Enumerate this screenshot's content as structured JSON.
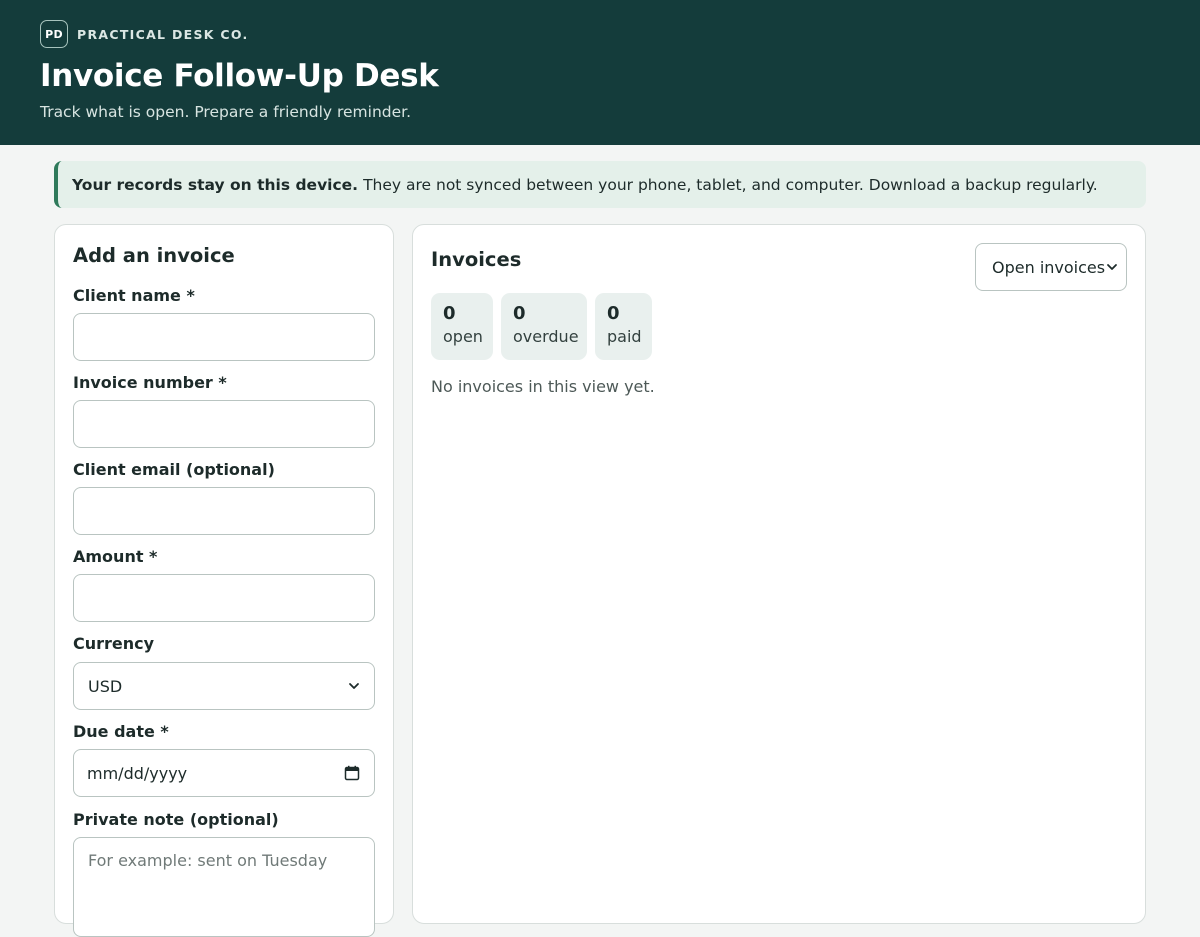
{
  "header": {
    "logo_text": "PD",
    "brand_name": "PRACTICAL DESK CO.",
    "title": "Invoice Follow-Up Desk",
    "subtitle": "Track what is open. Prepare a friendly reminder."
  },
  "notice": {
    "bold_text": "Your records stay on this device.",
    "text": "They are not synced between your phone, tablet, and computer. Download a backup regularly."
  },
  "form": {
    "title": "Add an invoice",
    "client_name": {
      "label": "Client name *",
      "value": ""
    },
    "invoice_number": {
      "label": "Invoice number *",
      "value": ""
    },
    "client_email": {
      "label": "Client email (optional)",
      "value": ""
    },
    "amount": {
      "label": "Amount *",
      "value": ""
    },
    "currency": {
      "label": "Currency",
      "value": "USD"
    },
    "due_date": {
      "label": "Due date *",
      "placeholder": "mm/dd/yyyy"
    },
    "private_note": {
      "label": "Private note (optional)",
      "placeholder": "For example: sent on Tuesday"
    }
  },
  "invoices": {
    "title": "Invoices",
    "filter_selected": "Open invoices",
    "stats": [
      {
        "value": "0",
        "label": "open"
      },
      {
        "value": "0",
        "label": "overdue"
      },
      {
        "value": "0",
        "label": "paid"
      }
    ],
    "empty_message": "No invoices in this view yet."
  },
  "colors": {
    "header_bg": "#143c3b",
    "accent": "#2f7a5b",
    "notice_bg": "#e4f0ea",
    "stat_bg": "#e9f0ee"
  }
}
